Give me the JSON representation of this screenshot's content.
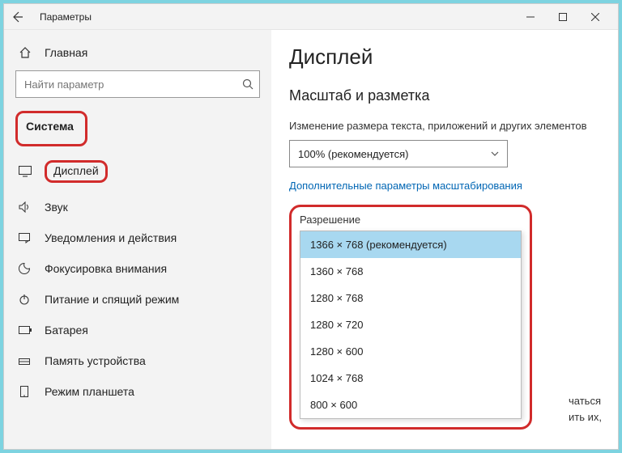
{
  "window": {
    "title": "Параметры"
  },
  "sidebar": {
    "home": "Главная",
    "search_placeholder": "Найти параметр",
    "section": "Система",
    "items": [
      {
        "label": "Дисплей"
      },
      {
        "label": "Звук"
      },
      {
        "label": "Уведомления и действия"
      },
      {
        "label": "Фокусировка внимания"
      },
      {
        "label": "Питание и спящий режим"
      },
      {
        "label": "Батарея"
      },
      {
        "label": "Память устройства"
      },
      {
        "label": "Режим планшета"
      }
    ]
  },
  "main": {
    "h1": "Дисплей",
    "h2": "Масштаб и разметка",
    "scale_desc": "Изменение размера текста, приложений и других элементов",
    "scale_value": "100% (рекомендуется)",
    "advanced_link": "Дополнительные параметры масштабирования",
    "resolution_label": "Разрешение",
    "resolutions": [
      "1366 × 768 (рекомендуется)",
      "1360 × 768",
      "1280 × 768",
      "1280 × 720",
      "1280 × 600",
      "1024 × 768",
      "800 × 600"
    ],
    "trail1": "чаться",
    "trail2": "ить их,"
  }
}
